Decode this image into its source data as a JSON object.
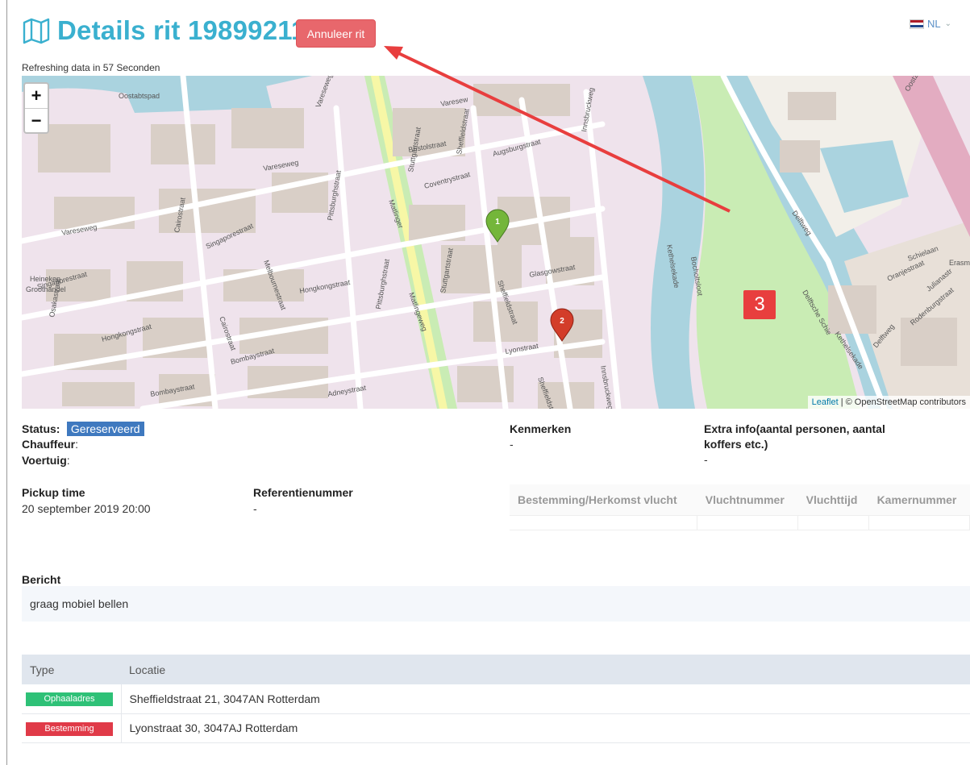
{
  "header": {
    "title": "Details rit 19899211",
    "cancel_label": "Annuleer rit",
    "language": "NL",
    "refresh_text": "Refreshing data in 57 Seconden"
  },
  "map": {
    "zoom_in": "+",
    "zoom_out": "−",
    "attribution_leaflet": "Leaflet",
    "attribution_osm": " | © OpenStreetMap contributors",
    "callout": "3",
    "markers": [
      {
        "label": "1",
        "color": "#74b63a"
      },
      {
        "label": "2",
        "color": "#d33d2a"
      }
    ],
    "labels": [
      {
        "text": "Oostabtspad"
      },
      {
        "text": "Vareseweg"
      },
      {
        "text": "Varesew"
      },
      {
        "text": "Vareseweg"
      },
      {
        "text": "Vareseweg"
      },
      {
        "text": "Bristolstraat"
      },
      {
        "text": "Sheffieldstraat"
      },
      {
        "text": "Augsburgstraat"
      },
      {
        "text": "Coventrystraat"
      },
      {
        "text": "Innsbruckweg"
      },
      {
        "text": "Stuttgartstraat"
      },
      {
        "text": "Matlinger"
      },
      {
        "text": "Pittsburghstraat"
      },
      {
        "text": "Cairostraat"
      },
      {
        "text": "Singaporestraat"
      },
      {
        "text": "Melbournestraat"
      },
      {
        "text": "Singaporestraat"
      },
      {
        "text": "Hongkongstraat"
      },
      {
        "text": "Glasgowstraat"
      },
      {
        "text": "Sheffieldstraat"
      },
      {
        "text": "Stuttgartstraat"
      },
      {
        "text": "Matlingeweg"
      },
      {
        "text": "Pittsburghstraat"
      },
      {
        "text": "Heineken"
      },
      {
        "text": "Groothandel"
      },
      {
        "text": "Osakastraat"
      },
      {
        "text": "Hongkongstraat"
      },
      {
        "text": "Cairostraat"
      },
      {
        "text": "Bombaystraat"
      },
      {
        "text": "Bombaystraat"
      },
      {
        "text": "Lyonstraat"
      },
      {
        "text": "Sheffieldstr"
      },
      {
        "text": "Innsbruckweg"
      },
      {
        "text": "Kethelsekade"
      },
      {
        "text": "Delftweg"
      },
      {
        "text": "Schielaan"
      },
      {
        "text": "Oranjestraat"
      },
      {
        "text": "Delftsche Schie"
      },
      {
        "text": "Rodenburgstraat"
      },
      {
        "text": "Delftweg"
      },
      {
        "text": "Erasmus"
      },
      {
        "text": "Julianastr"
      },
      {
        "text": "Kethelsekade"
      },
      {
        "text": "Oostzijde"
      },
      {
        "text": "Bocholtsloot"
      },
      {
        "text": "Adneystraat"
      }
    ]
  },
  "status": {
    "label": "Status",
    "value": "Gereserveerd",
    "chauffeur_label": "Chauffeur",
    "chauffeur_value": "",
    "voertuig_label": "Voertuig",
    "voertuig_value": ""
  },
  "kenmerken": {
    "label": "Kenmerken",
    "value": "-"
  },
  "extra_info": {
    "label_line1": "Extra info(aantal personen, aantal",
    "label_line2": "koffers etc.)",
    "value": "-"
  },
  "pickup": {
    "label": "Pickup time",
    "value": "20 september 2019 20:00"
  },
  "referentie": {
    "label": "Referentienummer",
    "value": "-"
  },
  "flight_table": {
    "headers": [
      "Bestemming/Herkomst vlucht",
      "Vluchtnummer",
      "Vluchttijd",
      "Kamernummer"
    ]
  },
  "bericht": {
    "label": "Bericht",
    "value": "graag mobiel bellen"
  },
  "locations": {
    "headers": [
      "Type",
      "Locatie"
    ],
    "rows": [
      {
        "type": "Ophaaladres",
        "color": "#2ec177",
        "location": "Sheffieldstraat 21, 3047AN Rotterdam"
      },
      {
        "type": "Bestemming",
        "color": "#e03a48",
        "location": "Lyonstraat 30, 3047AJ Rotterdam"
      }
    ]
  },
  "colors": {
    "title": "#3ab0cf",
    "cancel": "#e8676c",
    "status": "#3f79bf",
    "arrow": "#e83e3e"
  }
}
